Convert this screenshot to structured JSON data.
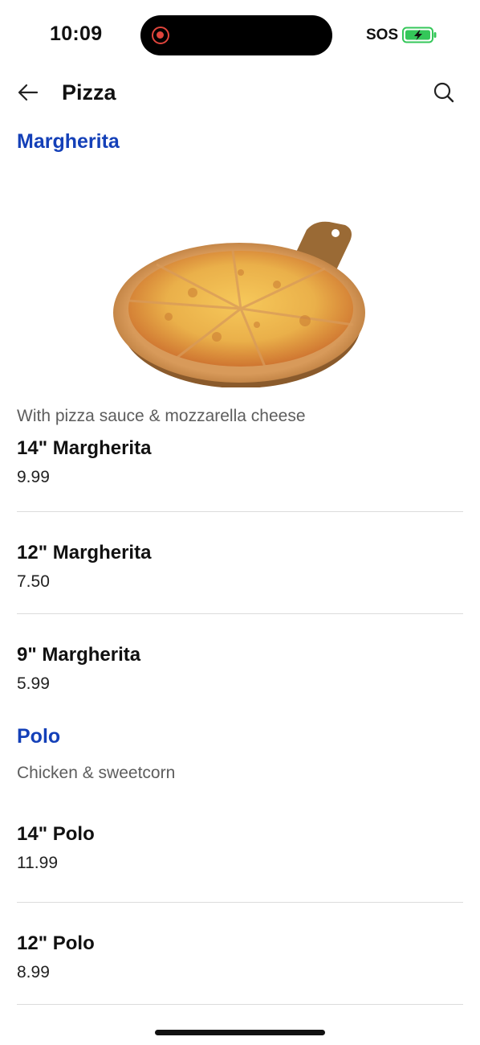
{
  "status_bar": {
    "time": "10:09",
    "carrier_text": "SOS",
    "battery_color": "#34c759",
    "recording_color": "#e0453c"
  },
  "app_bar": {
    "title": "Pizza",
    "back_icon": "arrow-left-icon",
    "search_icon": "search-icon"
  },
  "sections": [
    {
      "title": "Margherita",
      "description": "With pizza sauce & mozzarella cheese",
      "image": "margherita-pizza-on-board",
      "items": [
        {
          "name": "14\" Margherita",
          "price": "9.99"
        },
        {
          "name": "12\" Margherita",
          "price": "7.50"
        },
        {
          "name": "9\" Margherita",
          "price": "5.99"
        }
      ]
    },
    {
      "title": "Polo",
      "description": "Chicken & sweetcorn",
      "items": [
        {
          "name": "14\" Polo",
          "price": "11.99"
        },
        {
          "name": "12\" Polo",
          "price": "8.99"
        }
      ]
    }
  ],
  "accent_color": "#1440b8"
}
